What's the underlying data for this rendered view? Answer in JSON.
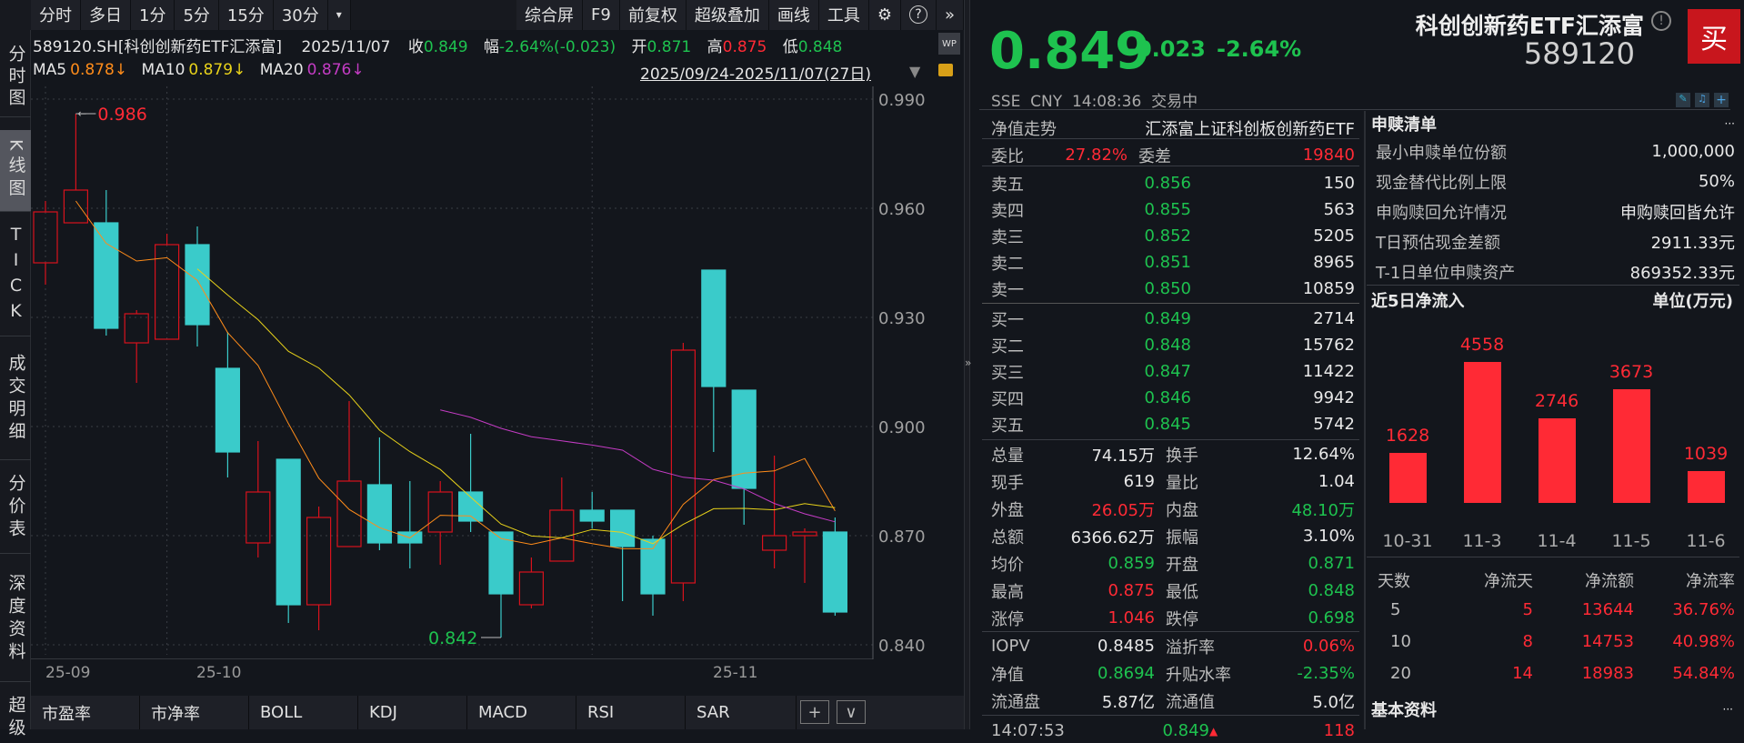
{
  "toolbar": {
    "periods": [
      "分时",
      "多日",
      "1分",
      "5分",
      "15分",
      "30分"
    ],
    "more": "▾",
    "tools": [
      "综合屏",
      "F9",
      "前复权",
      "超级叠加",
      "画线",
      "工具"
    ]
  },
  "sidebar": {
    "items": [
      "分时图",
      "K线图",
      "TICK",
      "成交明细",
      "分价表",
      "深度资料",
      "超级"
    ],
    "active": 1
  },
  "info": {
    "symbol": "589120.SH[科创创新药ETF汇添富]",
    "date": "2025/11/07",
    "close_label": "收",
    "close": "0.849",
    "chg_label": "幅",
    "chg": "-2.64%(-0.023)",
    "open_label": "开",
    "open": "0.871",
    "high_label": "高",
    "high": "0.875",
    "low_label": "低",
    "low": "0.848",
    "ma5_label": "MA5",
    "ma5": "0.878↓",
    "ma10_label": "MA10",
    "ma10": "0.879↓",
    "ma20_label": "MA20",
    "ma20": "0.876↓",
    "range": "2025/09/24-2025/11/07(27日)"
  },
  "chart_data": {
    "type": "candlestick",
    "ylim": [
      0.835,
      0.992
    ],
    "yticks": [
      "0.990",
      "0.960",
      "0.930",
      "0.900",
      "0.870",
      "0.840"
    ],
    "xticks": [
      {
        "i": 0,
        "label": "25-09"
      },
      {
        "i": 4,
        "label": "25-10"
      },
      {
        "i": 18,
        "label": "25-11"
      }
    ],
    "max_label": "0.986",
    "min_label": "0.842",
    "max_index": 1,
    "min_index": 15,
    "ohlc": [
      [
        0.945,
        0.962,
        0.939,
        0.959
      ],
      [
        0.956,
        0.986,
        0.956,
        0.965
      ],
      [
        0.956,
        0.965,
        0.925,
        0.927
      ],
      [
        0.923,
        0.932,
        0.912,
        0.931
      ],
      [
        0.924,
        0.953,
        0.924,
        0.95
      ],
      [
        0.95,
        0.955,
        0.922,
        0.928
      ],
      [
        0.916,
        0.926,
        0.886,
        0.893
      ],
      [
        0.868,
        0.896,
        0.864,
        0.882
      ],
      [
        0.891,
        0.891,
        0.846,
        0.851
      ],
      [
        0.851,
        0.878,
        0.844,
        0.875
      ],
      [
        0.867,
        0.907,
        0.867,
        0.885
      ],
      [
        0.884,
        0.897,
        0.866,
        0.868
      ],
      [
        0.871,
        0.885,
        0.861,
        0.868
      ],
      [
        0.871,
        0.885,
        0.862,
        0.882
      ],
      [
        0.882,
        0.898,
        0.871,
        0.874
      ],
      [
        0.871,
        0.871,
        0.842,
        0.854
      ],
      [
        0.851,
        0.864,
        0.85,
        0.86
      ],
      [
        0.863,
        0.886,
        0.863,
        0.877
      ],
      [
        0.877,
        0.882,
        0.872,
        0.874
      ],
      [
        0.877,
        0.877,
        0.852,
        0.867
      ],
      [
        0.869,
        0.87,
        0.848,
        0.854
      ],
      [
        0.857,
        0.923,
        0.852,
        0.921
      ],
      [
        0.943,
        0.943,
        0.893,
        0.911
      ],
      [
        0.91,
        0.91,
        0.873,
        0.883
      ],
      [
        0.866,
        0.892,
        0.861,
        0.87
      ],
      [
        0.87,
        0.872,
        0.857,
        0.871
      ],
      [
        0.871,
        0.875,
        0.848,
        0.849
      ]
    ],
    "colors": {
      "up": "#d8121c",
      "down": "#3acbca",
      "ma5": "#ff8c1a",
      "ma10": "#e8d21a",
      "ma20": "#c43cc4"
    }
  },
  "xaxis_labels": [
    "25-09",
    "25-10",
    "25-11"
  ],
  "tabs": [
    "市盈率",
    "市净率",
    "BOLL",
    "KDJ",
    "MACD",
    "RSI",
    "SAR"
  ],
  "tab_add": "+",
  "tab_more": "∨",
  "quote": {
    "price": "0.849",
    "change": "-0.023",
    "pct": "-2.64%",
    "name": "科创创新药ETF汇添富",
    "code": "589120",
    "buy": "买",
    "exchange": "SSE",
    "currency": "CNY",
    "time": "14:08:36",
    "status": "交易中"
  },
  "book": {
    "nav_label": "净值走势",
    "fund_name": "汇添富上证科创板创新药ETF",
    "wb_label": "委比",
    "wb": "27.82%",
    "wc_label": "委差",
    "wc": "19840",
    "asks": [
      {
        "label": "卖五",
        "price": "0.856",
        "vol": "150"
      },
      {
        "label": "卖四",
        "price": "0.855",
        "vol": "563"
      },
      {
        "label": "卖三",
        "price": "0.852",
        "vol": "5205"
      },
      {
        "label": "卖二",
        "price": "0.851",
        "vol": "8965"
      },
      {
        "label": "卖一",
        "price": "0.850",
        "vol": "10859"
      }
    ],
    "bids": [
      {
        "label": "买一",
        "price": "0.849",
        "vol": "2714"
      },
      {
        "label": "买二",
        "price": "0.848",
        "vol": "15762"
      },
      {
        "label": "买三",
        "price": "0.847",
        "vol": "11422"
      },
      {
        "label": "买四",
        "price": "0.846",
        "vol": "9942"
      },
      {
        "label": "买五",
        "price": "0.845",
        "vol": "5742"
      }
    ]
  },
  "stats": [
    [
      {
        "l": "总量",
        "v": "74.15万",
        "c": "white"
      },
      {
        "l": "换手",
        "v": "12.64%",
        "c": "white"
      }
    ],
    [
      {
        "l": "现手",
        "v": "619",
        "c": "white"
      },
      {
        "l": "量比",
        "v": "1.04",
        "c": "white"
      }
    ],
    [
      {
        "l": "外盘",
        "v": "26.05万",
        "c": "red"
      },
      {
        "l": "内盘",
        "v": "48.10万",
        "c": "green"
      }
    ],
    [
      {
        "l": "总额",
        "v": "6366.62万",
        "c": "white"
      },
      {
        "l": "振幅",
        "v": "3.10%",
        "c": "white"
      }
    ],
    [
      {
        "l": "均价",
        "v": "0.859",
        "c": "green"
      },
      {
        "l": "开盘",
        "v": "0.871",
        "c": "green"
      }
    ],
    [
      {
        "l": "最高",
        "v": "0.875",
        "c": "red"
      },
      {
        "l": "最低",
        "v": "0.848",
        "c": "green"
      }
    ],
    [
      {
        "l": "涨停",
        "v": "1.046",
        "c": "red"
      },
      {
        "l": "跌停",
        "v": "0.698",
        "c": "green"
      }
    ]
  ],
  "etf": [
    [
      {
        "l": "IOPV",
        "v": "0.8485",
        "c": "white"
      },
      {
        "l": "溢折率",
        "v": "0.06%",
        "c": "red"
      }
    ],
    [
      {
        "l": "净值",
        "v": "0.8694",
        "c": "green"
      },
      {
        "l": "升贴水率",
        "v": "-2.35%",
        "c": "green"
      }
    ],
    [
      {
        "l": "流通盘",
        "v": "5.87亿",
        "c": "white"
      },
      {
        "l": "流通值",
        "v": "5.0亿",
        "c": "white"
      }
    ]
  ],
  "tick": {
    "time": "14:07:53",
    "price": "0.849",
    "arrow": "▲",
    "vol": "118"
  },
  "redeem": {
    "title": "申赎清单",
    "more": "···",
    "rows": [
      {
        "l": "最小申赎单位份额",
        "v": "1,000,000"
      },
      {
        "l": "现金替代比例上限",
        "v": "50%"
      },
      {
        "l": "申购赎回允许情况",
        "v": "申购赎回皆允许"
      },
      {
        "l": "T日预估现金差额",
        "v": "2911.33元"
      },
      {
        "l": "T-1日单位申赎资产",
        "v": "869352.33元"
      }
    ]
  },
  "inflow": {
    "title": "近5日净流入",
    "unit": "单位(万元)",
    "bars": [
      {
        "date": "10-31",
        "value": 1628
      },
      {
        "date": "11-3",
        "value": 4558
      },
      {
        "date": "11-4",
        "value": 2746
      },
      {
        "date": "11-5",
        "value": 3673
      },
      {
        "date": "11-6",
        "value": 1039
      }
    ],
    "color": "#ff2a35"
  },
  "flow_table": {
    "headers": [
      "天数",
      "净流天",
      "净流额",
      "净流率"
    ],
    "rows": [
      [
        "5",
        "5",
        "13644",
        "36.76%"
      ],
      [
        "10",
        "8",
        "14753",
        "40.98%"
      ],
      [
        "20",
        "14",
        "18983",
        "54.84%"
      ]
    ]
  },
  "basic": {
    "title": "基本资料",
    "more": "···"
  }
}
